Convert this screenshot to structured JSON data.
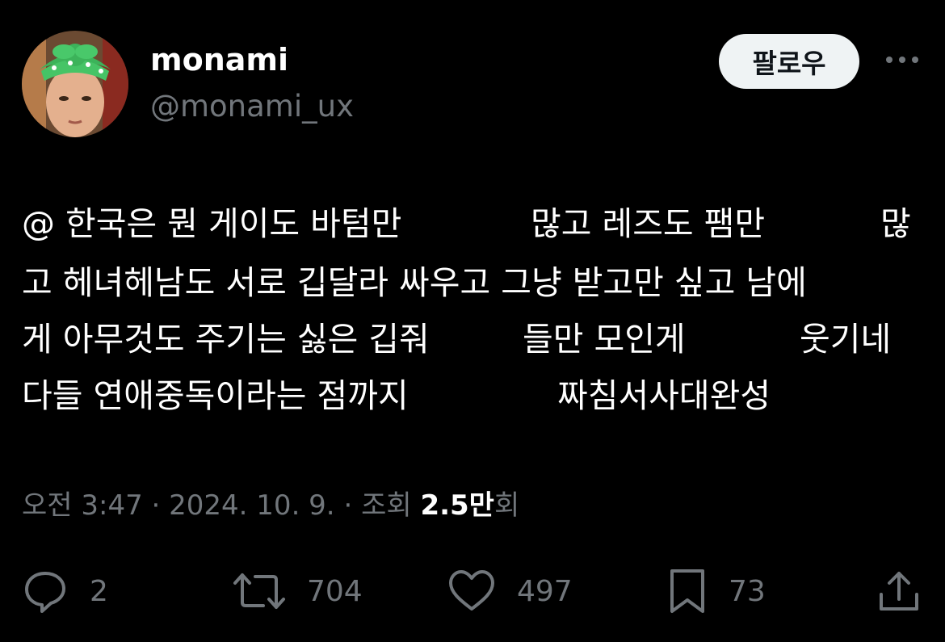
{
  "user": {
    "display_name": "monami",
    "handle": "@monami_ux",
    "avatar_icon": "profile-photo"
  },
  "header": {
    "follow_label": "팔로우",
    "more_icon": "more-icon"
  },
  "tweet": {
    "lines": [
      {
        "segments": [
          "@ 한국은 뭔 게이도 바텀만",
          "많고 레즈도 팸만",
          "많"
        ]
      },
      {
        "segments": [
          "고 헤녀헤남도 서로 깁달라 싸우고 그냥 받고만 싶고 남에"
        ]
      },
      {
        "segments": [
          "게 아무것도 주기는 싫은 깁줘",
          "들만 모인게",
          "웃기네"
        ]
      },
      {
        "segments": [
          "다들 연애중독이라는 점까지",
          "짜침서사대완성"
        ]
      }
    ]
  },
  "meta": {
    "time": "오전 3:47",
    "separator": "·",
    "date": "2024. 10. 9.",
    "views_prefix": "조회",
    "views_count": "2.5만",
    "views_suffix": "회"
  },
  "actions": {
    "reply": {
      "icon": "reply-icon",
      "count": "2"
    },
    "retweet": {
      "icon": "retweet-icon",
      "count": "704"
    },
    "like": {
      "icon": "heart-icon",
      "count": "497"
    },
    "bookmark": {
      "icon": "bookmark-icon",
      "count": "73"
    },
    "share": {
      "icon": "share-icon"
    }
  },
  "colors": {
    "background": "#000000",
    "text_primary": "#ffffff",
    "text_secondary": "#71767b",
    "button_bg": "#eff3f4",
    "button_text": "#0f1419"
  }
}
